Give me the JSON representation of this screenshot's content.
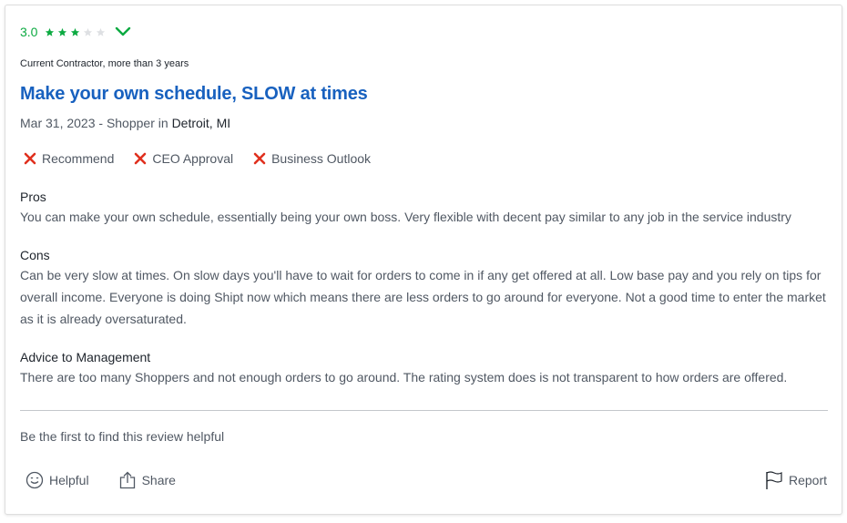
{
  "review": {
    "rating": {
      "value": "3.0",
      "stars_filled": 3,
      "stars_total": 5,
      "expand_icon": "chevron-down-icon"
    },
    "employment": "Current Contractor, more than 3 years",
    "title": "Make your own schedule, SLOW at times",
    "meta": {
      "date_role": "Mar 31, 2023 - Shopper",
      "in": " in ",
      "location": "Detroit, MI"
    },
    "ratings": [
      {
        "icon": "x-icon",
        "label": "Recommend"
      },
      {
        "icon": "x-icon",
        "label": "CEO Approval"
      },
      {
        "icon": "x-icon",
        "label": "Business Outlook"
      }
    ],
    "pros": {
      "label": "Pros",
      "text": "You can make your own schedule, essentially being your own boss. Very flexible with decent pay similar to any job in the service industry"
    },
    "cons": {
      "label": "Cons",
      "text": "Can be very slow at times. On slow days you'll have to wait for orders to come in if any get offered at all. Low base pay and you rely on tips for overall income. Everyone is doing Shipt now which means there are less orders to go around for everyone. Not a good time to enter the market as it is already oversaturated."
    },
    "advice": {
      "label": "Advice to Management",
      "text": "There are too many Shoppers and not enough orders to go around. The rating system does is not transparent to how orders are offered."
    },
    "helpful_note": "Be the first to find this review helpful",
    "actions": {
      "helpful_label": "Helpful",
      "share_label": "Share",
      "report_label": "Report"
    }
  },
  "colors": {
    "rating_green": "#0caa41",
    "title_blue": "#1861bf",
    "negative_red": "#e0301e",
    "star_empty": "#dee0e3"
  }
}
